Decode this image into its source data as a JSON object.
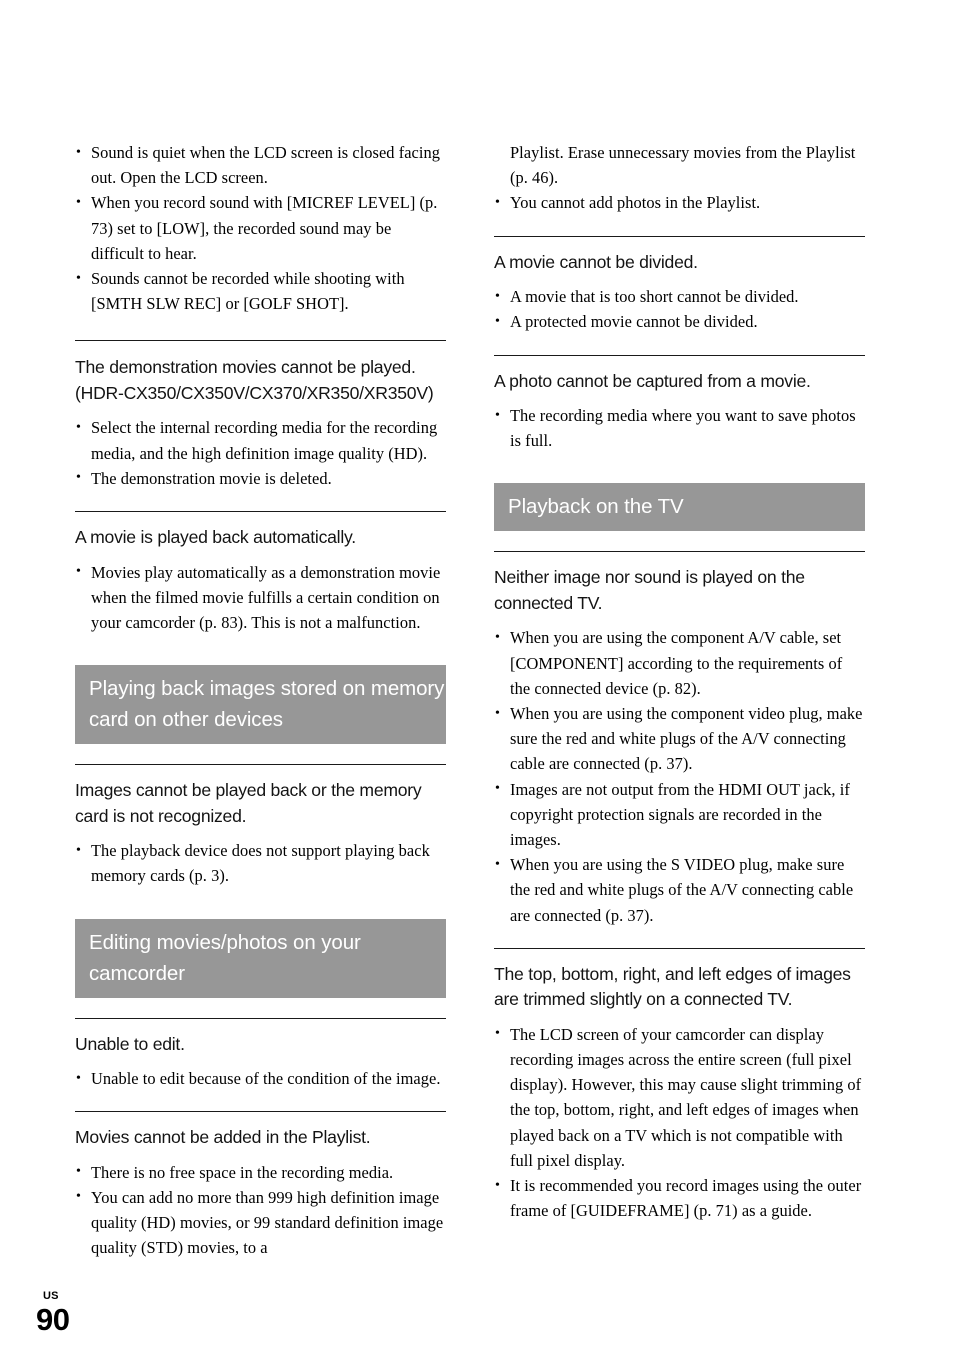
{
  "page": {
    "locale_code": "US",
    "page_number": "90",
    "banner_color": "#979797",
    "banner_text_color": "#ffffff",
    "text_color": "#000000"
  },
  "left_column": {
    "intro_bullets": [
      "Sound is quiet when the LCD screen is closed facing out. Open the LCD screen.",
      "When you record sound with [MICREF LEVEL] (p. 73) set to [LOW], the recorded sound may be difficult to hear.",
      "Sounds cannot be recorded while shooting with [SMTH SLW REC] or [GOLF SHOT]."
    ],
    "section_demo": {
      "heading": "The demonstration movies cannot be played. (HDR-CX350/CX350V/CX370/XR350/XR350V)",
      "bullets": [
        "Select the internal recording media for the recording media, and the high definition image quality (HD).",
        "The demonstration movie is deleted."
      ]
    },
    "section_auto_play": {
      "heading": "A movie is played back automatically.",
      "bullets": [
        "Movies play automatically as a demonstration movie when the filmed movie fulfills a certain condition on your camcorder (p. 83). This is not a malfunction."
      ]
    },
    "banner_memory_card": "Playing back images stored on memory card on other devices",
    "section_memory_card": {
      "heading": "Images cannot be played back or the memory card is not recognized.",
      "bullets": [
        "The playback device does not support playing back memory cards (p. 3)."
      ]
    },
    "banner_editing": "Editing movies/photos on your camcorder",
    "section_unable_edit": {
      "heading": "Unable to edit.",
      "bullets": [
        "Unable to edit because of the condition of the image."
      ]
    },
    "section_playlist": {
      "heading": "Movies cannot be added in the Playlist.",
      "bullets": [
        "There is no free space in the recording media.",
        "You can add no more than 999 high definition image quality (HD) movies, or 99 standard definition image quality (STD) movies, to a"
      ]
    }
  },
  "right_column": {
    "continuation_text": "Playlist. Erase unnecessary movies from the Playlist (p. 46).",
    "continuation_bullets": [
      "You cannot add photos in the Playlist."
    ],
    "section_divide": {
      "heading": "A movie cannot be divided.",
      "bullets": [
        "A movie that is too short cannot be divided.",
        "A protected movie cannot be divided."
      ]
    },
    "section_photo_capture": {
      "heading": "A photo cannot be captured from a movie.",
      "bullets": [
        "The recording media where you want to save photos is full."
      ]
    },
    "banner_playback_tv": "Playback on the TV",
    "section_no_image_sound": {
      "heading": "Neither image nor sound is played on the connected TV.",
      "bullets": [
        "When you are using the component A/V cable, set [COMPONENT] according to the requirements of the connected device (p. 82).",
        "When you are using the component video plug, make sure the red and white plugs of the A/V connecting cable are connected (p. 37).",
        "Images are not output from the HDMI OUT jack, if copyright protection signals are recorded in the images.",
        "When you are using the S VIDEO plug, make sure the red and white plugs of the A/V connecting cable are connected (p. 37)."
      ]
    },
    "section_trimmed_edges": {
      "heading": "The top, bottom, right, and left edges of images are trimmed slightly on a connected TV.",
      "bullets": [
        "The LCD screen of your camcorder can display recording images across the entire screen (full pixel display). However, this may cause slight trimming of the top, bottom, right, and left edges of images when played back on a TV which is not compatible with full pixel display.",
        "It is recommended you record images using the outer frame of [GUIDEFRAME] (p. 71) as a guide."
      ]
    }
  }
}
